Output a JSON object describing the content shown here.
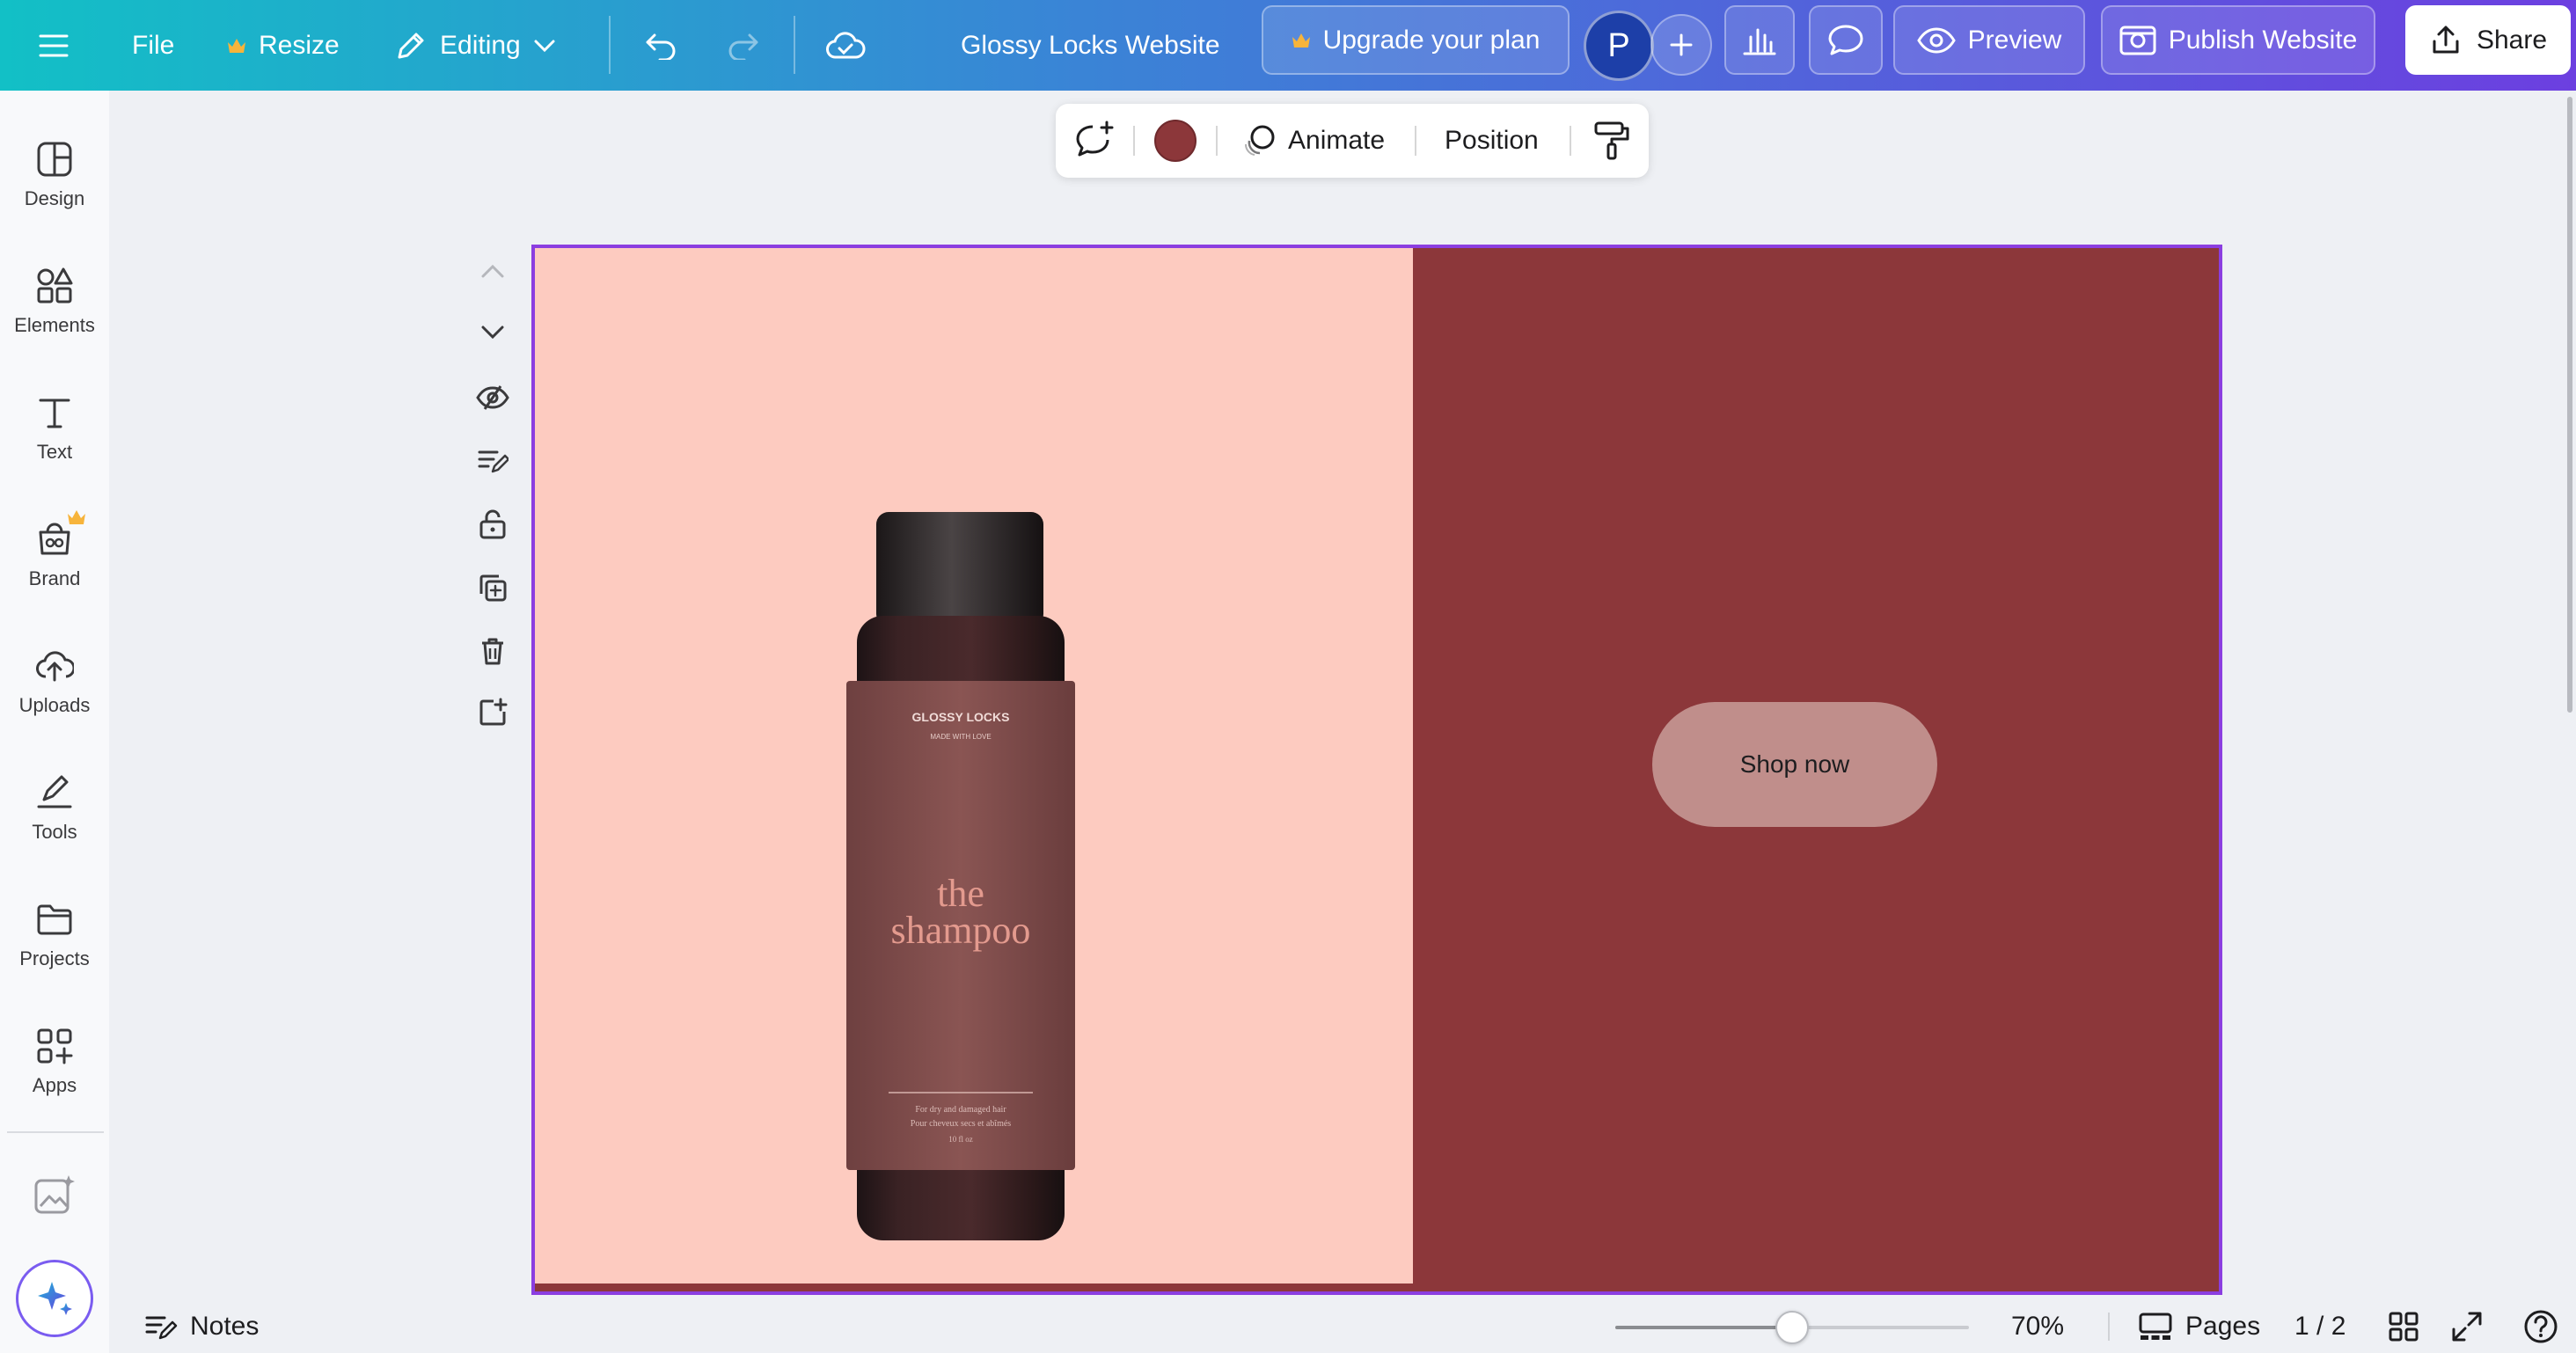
{
  "topbar": {
    "file_label": "File",
    "resize_label": "Resize",
    "editing_label": "Editing",
    "document_title": "Glossy Locks Website",
    "upgrade_label": "Upgrade your plan",
    "avatar_initial": "P",
    "preview_label": "Preview",
    "publish_label": "Publish Website",
    "share_label": "Share"
  },
  "sidebar": {
    "items": [
      {
        "label": "Design",
        "icon": "design-icon"
      },
      {
        "label": "Elements",
        "icon": "elements-icon"
      },
      {
        "label": "Text",
        "icon": "text-icon"
      },
      {
        "label": "Brand",
        "icon": "brand-icon"
      },
      {
        "label": "Uploads",
        "icon": "uploads-icon"
      },
      {
        "label": "Tools",
        "icon": "tools-icon"
      },
      {
        "label": "Projects",
        "icon": "projects-icon"
      },
      {
        "label": "Apps",
        "icon": "apps-icon"
      }
    ]
  },
  "context_toolbar": {
    "animate_label": "Animate",
    "position_label": "Position",
    "swatch_color": "#8c373a"
  },
  "canvas": {
    "left_bg": "#fdcbc0",
    "right_bg": "#8c373a",
    "shop_button_label": "Shop now",
    "bottle_brand": "GLOSSY LOCKS",
    "bottle_tagline": "MADE WITH LOVE",
    "bottle_title_line1": "the",
    "bottle_title_line2": "shampoo",
    "bottle_small_line1": "For dry and damaged hair",
    "bottle_small_line2": "Pour cheveux secs et abîmés",
    "bottle_small_line3": "10 fl oz"
  },
  "bottombar": {
    "notes_label": "Notes",
    "zoom_value": "70%",
    "zoom_fraction": 0.5,
    "pages_label": "Pages",
    "page_count": "1 / 2"
  },
  "colors": {
    "accent": "#8b3ee0",
    "topbar_start": "#12c0c6",
    "topbar_end": "#6c3fe0"
  }
}
